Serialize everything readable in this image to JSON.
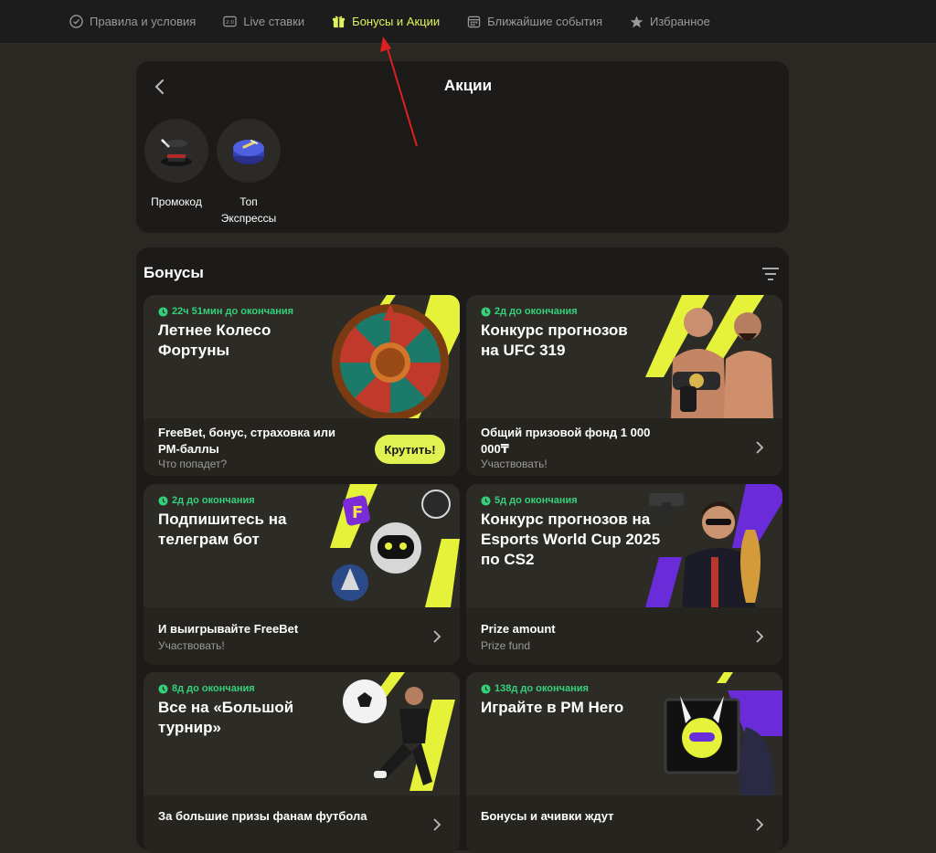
{
  "nav": {
    "items": [
      {
        "label": "Правила и условия",
        "icon": "check-circle-icon"
      },
      {
        "label": "Live ставки",
        "icon": "scoreboard-icon"
      },
      {
        "label": "Бонусы и Акции",
        "icon": "gift-icon"
      },
      {
        "label": "Ближайшие события",
        "icon": "calendar-icon"
      },
      {
        "label": "Избранное",
        "icon": "star-icon"
      }
    ]
  },
  "promotions": {
    "title": "Акции",
    "items": [
      {
        "label": "Промокод",
        "icon": "magic-hat-icon"
      },
      {
        "label": "Топ Экспрессы",
        "icon": "puck-icon"
      }
    ]
  },
  "bonuses": {
    "title": "Бонусы",
    "cards": [
      {
        "timer": "22ч 51мин до окончания",
        "title": "Летнее Колесо Фортуны",
        "main": "FreeBet, бонус, страховка или PM-баллы",
        "sub": "Что попадет?",
        "button": "Крутить!"
      },
      {
        "timer": "2д до окончания",
        "title": "Конкурс прогнозов на UFC 319",
        "main": "Общий призовой фонд 1 000 000₸",
        "sub": "Участвовать!"
      },
      {
        "timer": "2д до окончания",
        "title": "Подпишитесь на телеграм бот",
        "main": "И выигрывайте FreeBet",
        "sub": "Участвовать!"
      },
      {
        "timer": "5д до окончания",
        "title": "Конкурс прогнозов на Esports World Cup 2025 по CS2",
        "main": "Prize amount",
        "sub": "Prize fund"
      },
      {
        "timer": "8д до окончания",
        "title": "Все на «Большой турнир»",
        "main": "За большие призы фанам футбола",
        "sub": ""
      },
      {
        "timer": "138д до окончания",
        "title": "Играйте в PM Hero",
        "main": "Бонусы и ачивки ждут",
        "sub": ""
      }
    ]
  },
  "colors": {
    "accent": "#e0f252",
    "timer": "#35d07a",
    "background": "#2a2822",
    "panel": "#1c1b19",
    "annotation_arrow": "#e02020"
  }
}
